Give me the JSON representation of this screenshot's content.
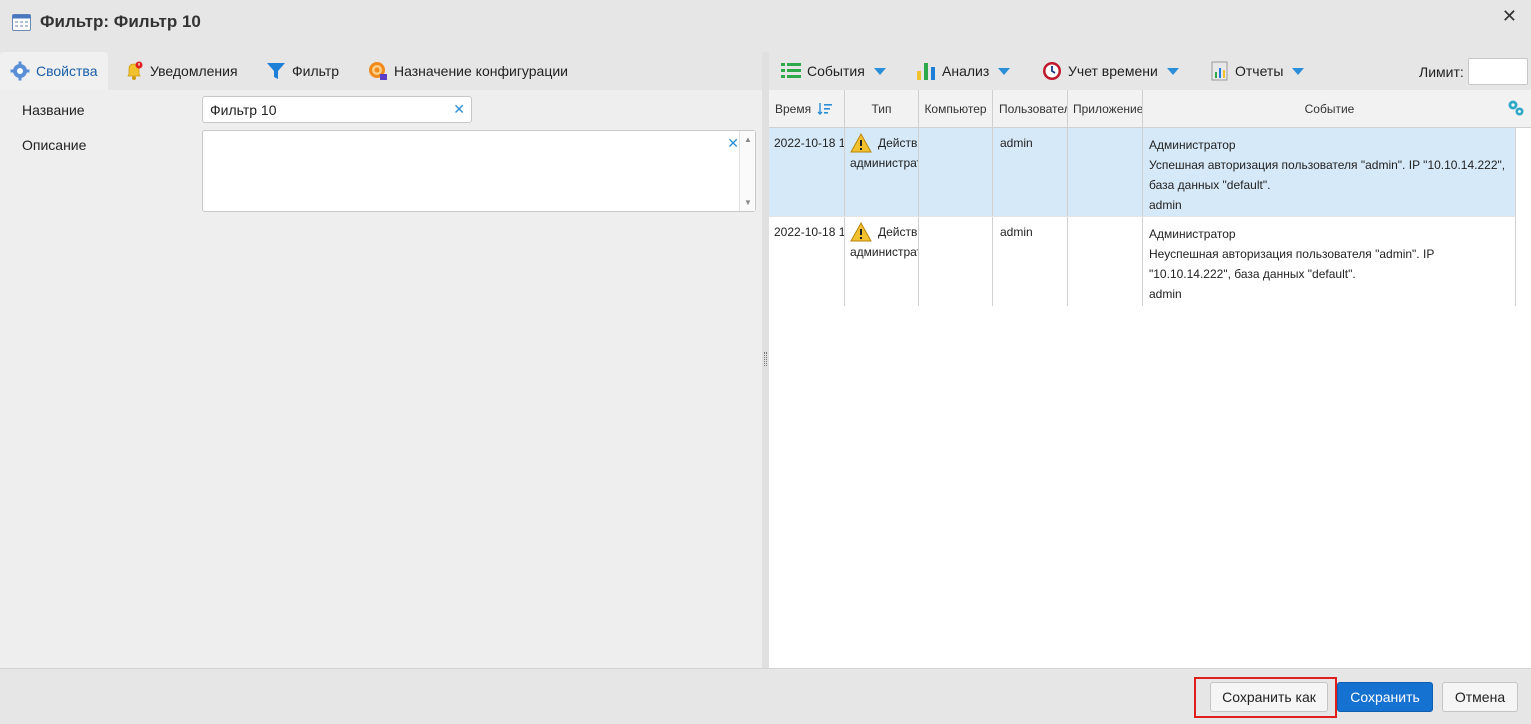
{
  "window": {
    "title": "Фильтр: Фильтр 10",
    "close_label": "✕"
  },
  "tabs": [
    {
      "label": "Свойства",
      "icon": "settings-gear-icon",
      "active": true
    },
    {
      "label": "Уведомления",
      "icon": "bell-alert-icon",
      "active": false
    },
    {
      "label": "Фильтр",
      "icon": "funnel-icon",
      "active": false
    },
    {
      "label": "Назначение конфигурации",
      "icon": "config-target-icon",
      "active": false
    }
  ],
  "form": {
    "name_label": "Название",
    "name_value": "Фильтр 10",
    "description_label": "Описание",
    "description_value": ""
  },
  "toolbar": {
    "events_label": "События",
    "analysis_label": "Анализ",
    "time_label": "Учет времени",
    "reports_label": "Отчеты",
    "limit_label": "Лимит:",
    "limit_value": ""
  },
  "grid": {
    "columns": [
      "Время",
      "Тип",
      "Компьютер",
      "Пользовател",
      "Приложение",
      "Событие"
    ],
    "rows": [
      {
        "time": "2022-10-18 1",
        "type_line1": "Действ",
        "type_line2": "администрат",
        "computer": "",
        "user": "admin",
        "app": "",
        "event_lines": [
          "Администратор",
          "Успешная авторизация пользователя \"admin\". IP \"10.10.14.222\",",
          "база данных \"default\".",
          "admin"
        ],
        "selected": true
      },
      {
        "time": "2022-10-18 1",
        "type_line1": "Действ",
        "type_line2": "администрат",
        "computer": "",
        "user": "admin",
        "app": "",
        "event_lines": [
          "Администратор",
          "Неуспешная авторизация пользователя \"admin\". IP",
          "\"10.10.14.222\", база данных \"default\".",
          "admin"
        ],
        "selected": false
      }
    ]
  },
  "footer": {
    "save_as_label": "Сохранить как",
    "save_label": "Сохранить",
    "cancel_label": "Отмена"
  },
  "colors": {
    "accent": "#1572d0",
    "selected_row": "#d6e9f8",
    "highlight": "#e01e1e"
  }
}
